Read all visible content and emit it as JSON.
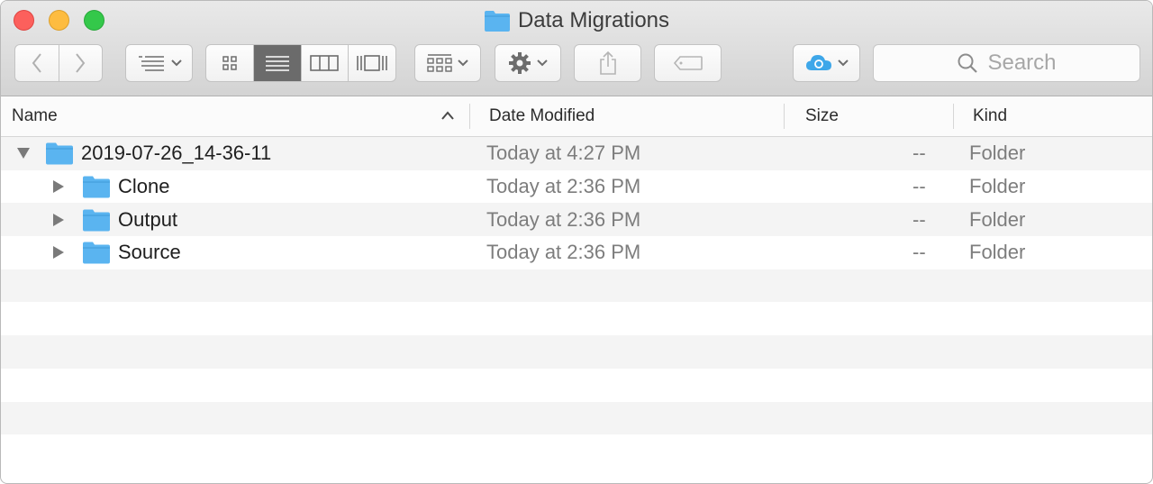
{
  "window": {
    "title": "Data Migrations"
  },
  "search": {
    "placeholder": "Search"
  },
  "columns": {
    "name": "Name",
    "date": "Date Modified",
    "size": "Size",
    "kind": "Kind"
  },
  "rows": [
    {
      "name": "2019-07-26_14-36-11",
      "date": "Today at 4:27 PM",
      "size": "--",
      "kind": "Folder",
      "expanded": true,
      "level": 0
    },
    {
      "name": "Clone",
      "date": "Today at 2:36 PM",
      "size": "--",
      "kind": "Folder",
      "expanded": false,
      "level": 1
    },
    {
      "name": "Output",
      "date": "Today at 2:36 PM",
      "size": "--",
      "kind": "Folder",
      "expanded": false,
      "level": 1
    },
    {
      "name": "Source",
      "date": "Today at 2:36 PM",
      "size": "--",
      "kind": "Folder",
      "expanded": false,
      "level": 1
    }
  ],
  "toolbar": {
    "view_mode_selected": "list",
    "icons": [
      "back-icon",
      "forward-icon",
      "arrange-icon",
      "icon-view-icon",
      "list-view-icon",
      "column-view-icon",
      "gallery-view-icon",
      "group-icon",
      "gear-icon",
      "share-icon",
      "tag-icon",
      "icloud-icon",
      "search-icon"
    ]
  },
  "colors": {
    "close": "#fc605c",
    "minimize": "#fdbc40",
    "zoom": "#34c84a",
    "folder": "#5ab4f0",
    "active_segment": "#6b6b6b"
  }
}
